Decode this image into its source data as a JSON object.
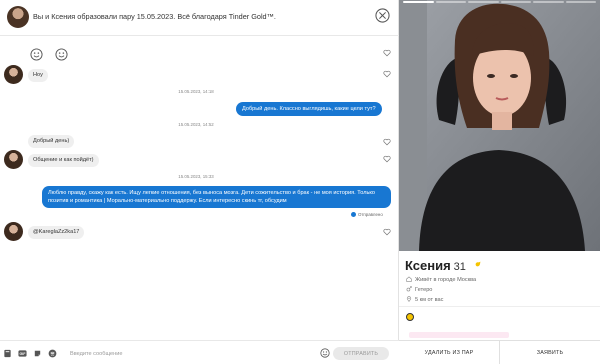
{
  "header": {
    "match_text": "Вы и Ксения образовали пару 15.05.2023. Всё благодаря Tinder Gold™."
  },
  "messages": [
    {
      "type": "in",
      "text": "Ноу"
    },
    {
      "type": "ts",
      "text": "15.05.2023, 14:18"
    },
    {
      "type": "out",
      "text": "Добрый день. Классно выглядишь, какие цели тут?"
    },
    {
      "type": "ts",
      "text": "15.05.2023, 14:52"
    },
    {
      "type": "in",
      "text": "Добрый день)"
    },
    {
      "type": "in",
      "text": "Общение и как пойдёт)"
    },
    {
      "type": "ts",
      "text": "15.05.2023, 15:33"
    },
    {
      "type": "out",
      "text": "Люблю правду, скажу как есть. Ищу легкие отношения, без выноса мозга. Дети сожительство и брак - не моя история. Только позитив и романтика | Морально-материально поддержу. Если интересно скинь тг, обсудим"
    },
    {
      "type": "in",
      "text": "@KareglaZz2ka17"
    }
  ],
  "status_label": "Отправлено",
  "composer": {
    "placeholder": "Введите сообщение",
    "send_label": "ОТПРАВИТЬ"
  },
  "profile": {
    "name": "Ксения",
    "age": "31",
    "lives": "Живёт в городе Москва",
    "orientation": "Гетеро",
    "distance": "5 км от вас",
    "unmatch_label": "УДАЛИТЬ ИЗ ПАР",
    "report_label": "ЗАЯВИТЬ",
    "photo_count": 6,
    "active_photo": 1
  },
  "colors": {
    "accent": "#1877d2",
    "bubble_in": "#efefef",
    "badge": "#f5c400"
  },
  "icons": {
    "close": "close-circle-icon",
    "heart": "heart-outline-icon",
    "emoji": "smile-icon",
    "composer": [
      "book-icon",
      "gif-icon",
      "sticker-icon",
      "music-icon",
      "emoji-icon"
    ],
    "profile_info": [
      "home-icon",
      "gender-icon",
      "location-pin-icon"
    ]
  }
}
